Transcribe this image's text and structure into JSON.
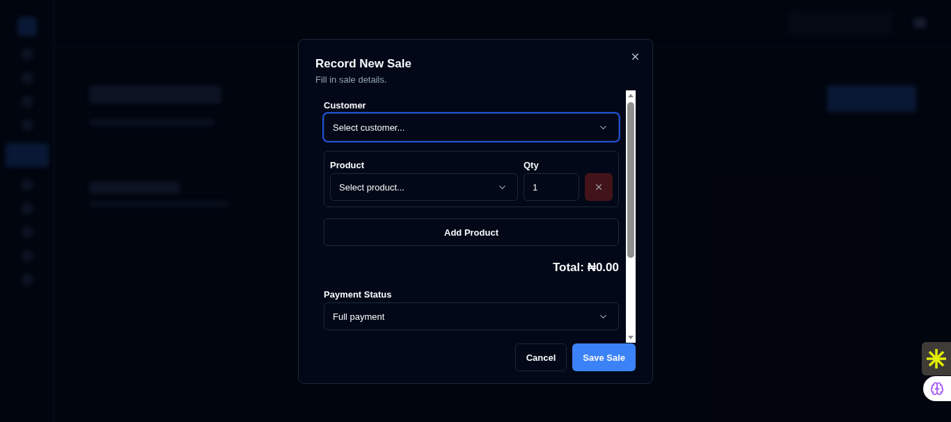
{
  "dialog": {
    "title": "Record New Sale",
    "subtitle": "Fill in sale details."
  },
  "customer": {
    "label": "Customer",
    "placeholder": "Select customer...",
    "focused": true
  },
  "line_items": [
    {
      "product_label": "Product",
      "product_placeholder": "Select product...",
      "qty_label": "Qty",
      "qty_value": "1"
    }
  ],
  "add_button": "Add Product",
  "total": "Total: ₦0.00",
  "payment_status": {
    "label": "Payment Status",
    "value": "Full payment"
  },
  "buttons": [
    {
      "label": "Cancel",
      "kind": "secondary"
    },
    {
      "label": "Save Sale",
      "kind": "primary"
    }
  ]
}
